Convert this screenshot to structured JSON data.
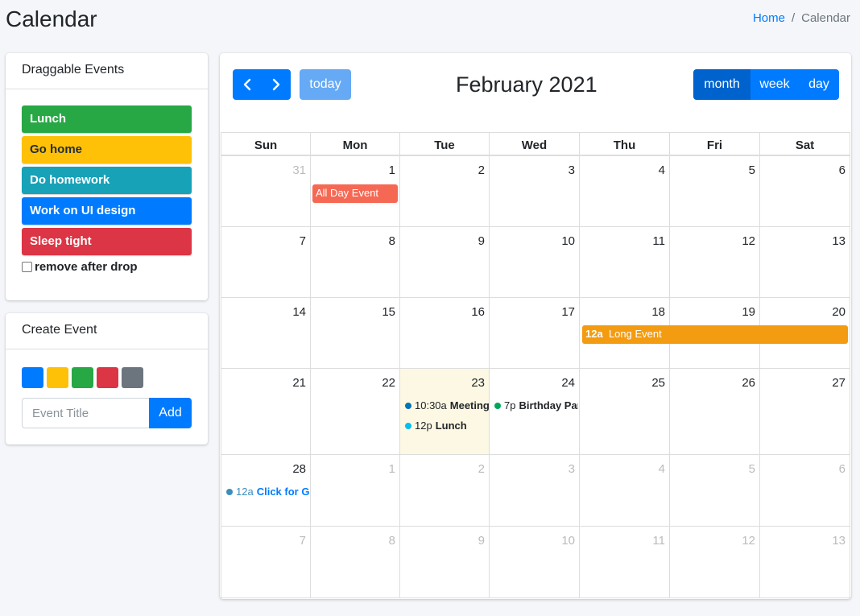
{
  "page": {
    "title": "Calendar"
  },
  "breadcrumb": {
    "home": "Home",
    "separator": "/",
    "current": "Calendar"
  },
  "draggable": {
    "title": "Draggable Events",
    "events": [
      {
        "label": "Lunch",
        "color": "#28a745"
      },
      {
        "label": "Go home",
        "color": "#ffc107"
      },
      {
        "label": "Do homework",
        "color": "#17a2b8"
      },
      {
        "label": "Work on UI design",
        "color": "#007bff"
      },
      {
        "label": "Sleep tight",
        "color": "#dc3545"
      }
    ],
    "remove_label": "remove after drop",
    "remove_checked": false
  },
  "create": {
    "title": "Create Event",
    "colors": [
      "#007bff",
      "#ffc107",
      "#28a745",
      "#dc3545",
      "#6c757d"
    ],
    "input_placeholder": "Event Title",
    "input_value": "",
    "add_label": "Add"
  },
  "calendar": {
    "prev_icon": "chevron-left-icon",
    "next_icon": "chevron-right-icon",
    "today_label": "today",
    "title": "February 2021",
    "views": {
      "month": "month",
      "week": "week",
      "day": "day",
      "active": "month"
    },
    "days_of_week": [
      "Sun",
      "Mon",
      "Tue",
      "Wed",
      "Thu",
      "Fri",
      "Sat"
    ],
    "weeks": [
      [
        "31",
        "1",
        "2",
        "3",
        "4",
        "5",
        "6"
      ],
      [
        "7",
        "8",
        "9",
        "10",
        "11",
        "12",
        "13"
      ],
      [
        "14",
        "15",
        "16",
        "17",
        "18",
        "19",
        "20"
      ],
      [
        "21",
        "22",
        "23",
        "24",
        "25",
        "26",
        "27"
      ],
      [
        "28",
        "1",
        "2",
        "3",
        "4",
        "5",
        "6"
      ],
      [
        "7",
        "8",
        "9",
        "10",
        "11",
        "12",
        "13"
      ]
    ],
    "events": {
      "all_day": {
        "label": "All Day Event",
        "color": "#f56954"
      },
      "long_event": {
        "time": "12a",
        "label": "Long Event",
        "color": "#f39c12"
      },
      "meeting": {
        "time": "10:30a",
        "label": "Meeting",
        "color": "#0073b7"
      },
      "lunch": {
        "time": "12p",
        "label": "Lunch",
        "color": "#00c0ef"
      },
      "birthday": {
        "time": "7p",
        "label": "Birthday Party",
        "color": "#00a65a"
      },
      "click_google": {
        "time": "12a",
        "label": "Click for Google",
        "color": "#3c8dbc"
      }
    }
  }
}
